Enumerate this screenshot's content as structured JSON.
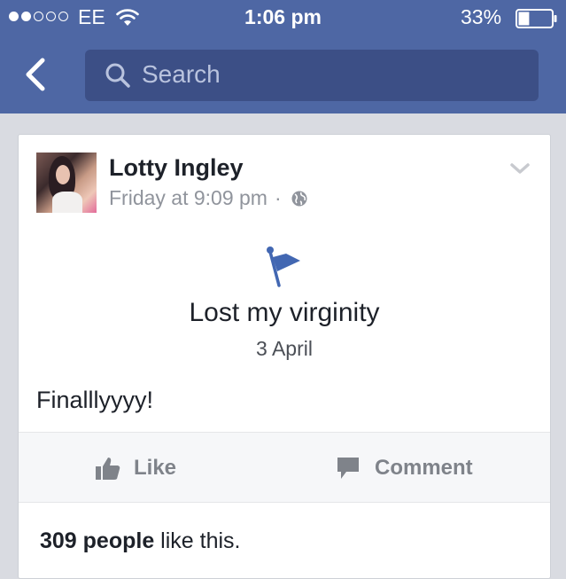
{
  "status_bar": {
    "carrier": "EE",
    "time": "1:06 pm",
    "battery_percent": "33%",
    "signal_bars_filled": 2,
    "signal_bars_total": 5,
    "battery_level": 0.33,
    "wifi_icon": "wifi-icon",
    "battery_icon": "battery-icon"
  },
  "nav_bar": {
    "back_icon": "back-chevron-icon",
    "search_placeholder": "Search",
    "search_value": ""
  },
  "post": {
    "author": "Lotty Ingley",
    "timestamp": "Friday at 9:09 pm",
    "separator": "·",
    "privacy_icon": "globe-icon",
    "life_event": {
      "icon": "flag-icon",
      "title": "Lost my virginity",
      "date": "3 April"
    },
    "text": "Finalllyyyy!",
    "actions": {
      "like_label": "Like",
      "comment_label": "Comment"
    },
    "likes_count": "309 people",
    "likes_suffix": " like this."
  },
  "colors": {
    "header_blue": "#4e67a4",
    "search_bg": "#3c4f86",
    "flag_blue": "#4267b2",
    "meta_gray": "#90949c"
  }
}
